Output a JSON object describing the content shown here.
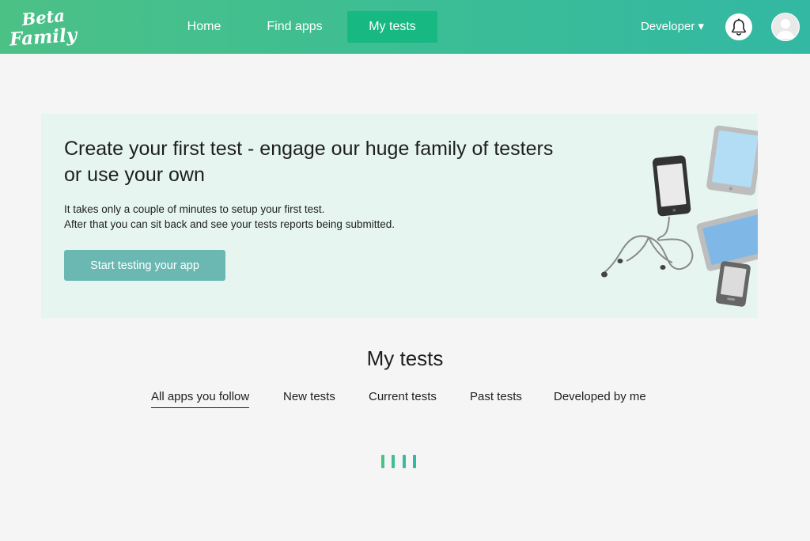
{
  "header": {
    "logo": {
      "line1": "Beta",
      "line2": "Family"
    },
    "nav": [
      {
        "label": "Home"
      },
      {
        "label": "Find apps"
      },
      {
        "label": "My tests",
        "active": true
      }
    ],
    "developer_menu": "Developer ▾",
    "colors": {
      "gradient_start": "#4cc186",
      "gradient_end": "#33b8a3",
      "active_nav": "#17b882"
    }
  },
  "banner": {
    "title": "Create your first test - engage our huge family of testers or use your own",
    "text_line1": "It takes only a couple of minutes to setup your first test.",
    "text_line2": "After that you can sit back and see your tests reports being submitted.",
    "button": "Start testing your app",
    "colors": {
      "background": "#e6f5f0",
      "button": "#6bb8b3"
    }
  },
  "my_tests": {
    "title": "My tests",
    "tabs": [
      {
        "label": "All apps you follow",
        "active": true
      },
      {
        "label": "New tests"
      },
      {
        "label": "Current tests"
      },
      {
        "label": "Past tests"
      },
      {
        "label": "Developed by me"
      }
    ]
  },
  "loader": {
    "colors": [
      "#4cc186",
      "#3fbe94",
      "#38bba0",
      "#33b8a8"
    ]
  }
}
